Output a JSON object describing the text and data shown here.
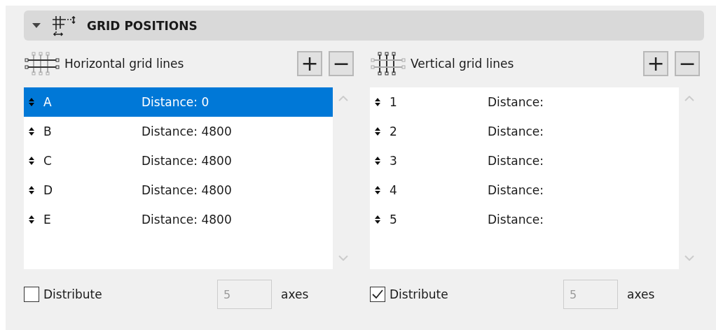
{
  "section": {
    "title": "GRID POSITIONS",
    "expanded": true
  },
  "panels": [
    {
      "title": "Horizontal grid lines",
      "kind": "horizontal",
      "add": "+",
      "remove": "−",
      "rows": [
        {
          "name": "A",
          "distance": "Distance: 0",
          "selected": true
        },
        {
          "name": "B",
          "distance": "Distance: 4800",
          "selected": false
        },
        {
          "name": "C",
          "distance": "Distance: 4800",
          "selected": false
        },
        {
          "name": "D",
          "distance": "Distance: 4800",
          "selected": false
        },
        {
          "name": "E",
          "distance": "Distance: 4800",
          "selected": false
        }
      ],
      "distribute": {
        "label": "Distribute",
        "checked": false,
        "count": "5",
        "disabled": true,
        "unit": "axes"
      }
    },
    {
      "title": "Vertical grid lines",
      "kind": "vertical",
      "add": "+",
      "remove": "−",
      "rows": [
        {
          "name": "1",
          "distance": "Distance:",
          "selected": false
        },
        {
          "name": "2",
          "distance": "Distance:",
          "selected": false
        },
        {
          "name": "3",
          "distance": "Distance:",
          "selected": false
        },
        {
          "name": "4",
          "distance": "Distance:",
          "selected": false
        },
        {
          "name": "5",
          "distance": "Distance:",
          "selected": false
        }
      ],
      "distribute": {
        "label": "Distribute",
        "checked": true,
        "count": "5",
        "disabled": true,
        "unit": "axes"
      }
    }
  ]
}
